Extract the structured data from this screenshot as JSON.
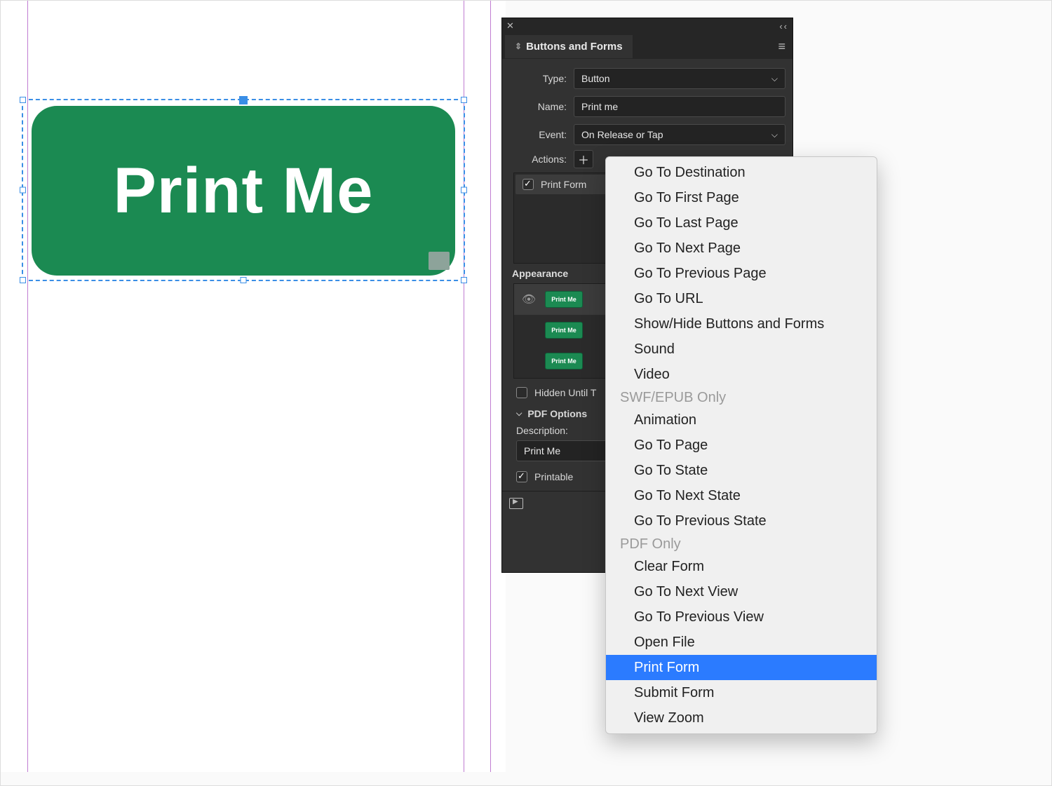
{
  "canvas": {
    "button_text": "Print Me"
  },
  "panel": {
    "title": "Buttons and Forms",
    "type_label": "Type:",
    "type_value": "Button",
    "name_label": "Name:",
    "name_value": "Print me",
    "event_label": "Event:",
    "event_value": "On Release or Tap",
    "actions_label": "Actions:",
    "action_items": [
      {
        "label": "Print Form",
        "checked": true
      }
    ],
    "appearance_label": "Appearance",
    "appearance_states": [
      {
        "thumb": "Print Me",
        "visible": true
      },
      {
        "thumb": "Print Me",
        "visible": false
      },
      {
        "thumb": "Print Me",
        "visible": false
      }
    ],
    "hidden_label_partial": "Hidden Until T",
    "pdf_options_label": "PDF Options",
    "description_label": "Description:",
    "description_value": "Print Me",
    "printable_label": "Printable"
  },
  "menu": {
    "items_top": [
      "Go To Destination",
      "Go To First Page",
      "Go To Last Page",
      "Go To Next Page",
      "Go To Previous Page",
      "Go To URL",
      "Show/Hide Buttons and Forms",
      "Sound",
      "Video"
    ],
    "section_swf": "SWF/EPUB Only",
    "items_swf": [
      "Animation",
      "Go To Page",
      "Go To State",
      "Go To Next State",
      "Go To Previous State"
    ],
    "section_pdf": "PDF Only",
    "items_pdf": [
      "Clear Form",
      "Go To Next View",
      "Go To Previous View",
      "Open File",
      "Print Form",
      "Submit Form",
      "View Zoom"
    ],
    "selected": "Print Form"
  }
}
